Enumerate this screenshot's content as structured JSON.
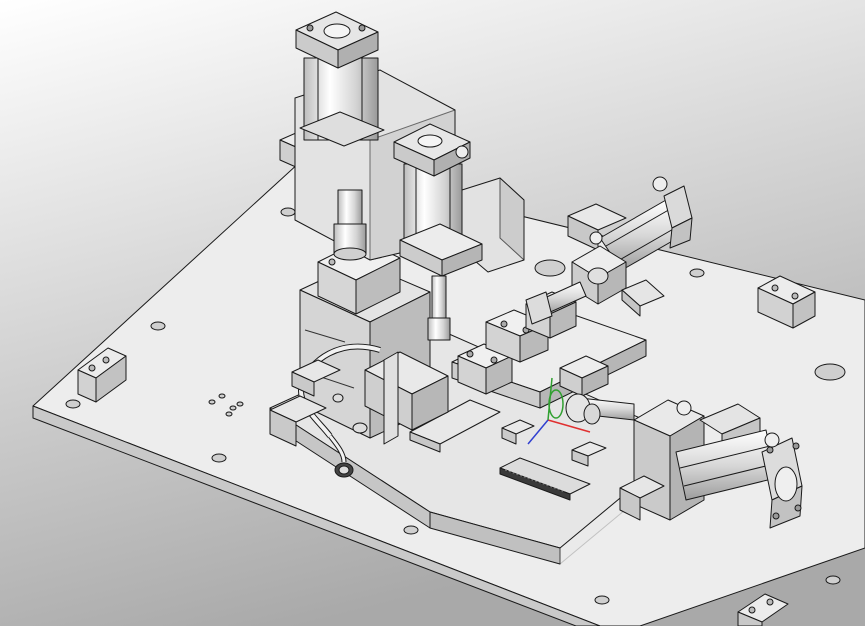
{
  "viewport": {
    "background_top": "#ffffff",
    "background_bottom": "#a9a9a9",
    "part_fill": "#ececec",
    "part_shade": "#c9c9c9",
    "edge_color": "#1a1a1a",
    "axis_colors": {
      "x": "#e03030",
      "y": "#30a030",
      "z": "#3040d0"
    }
  },
  "components": [
    {
      "name": "base-plate"
    },
    {
      "name": "top-vertical-cylinder"
    },
    {
      "name": "second-vertical-cylinder"
    },
    {
      "name": "right-upper-horizontal-cylinder"
    },
    {
      "name": "right-lower-horizontal-cylinder"
    },
    {
      "name": "press-block"
    },
    {
      "name": "linear-rail"
    },
    {
      "name": "locating-blocks"
    },
    {
      "name": "air-hose"
    }
  ]
}
